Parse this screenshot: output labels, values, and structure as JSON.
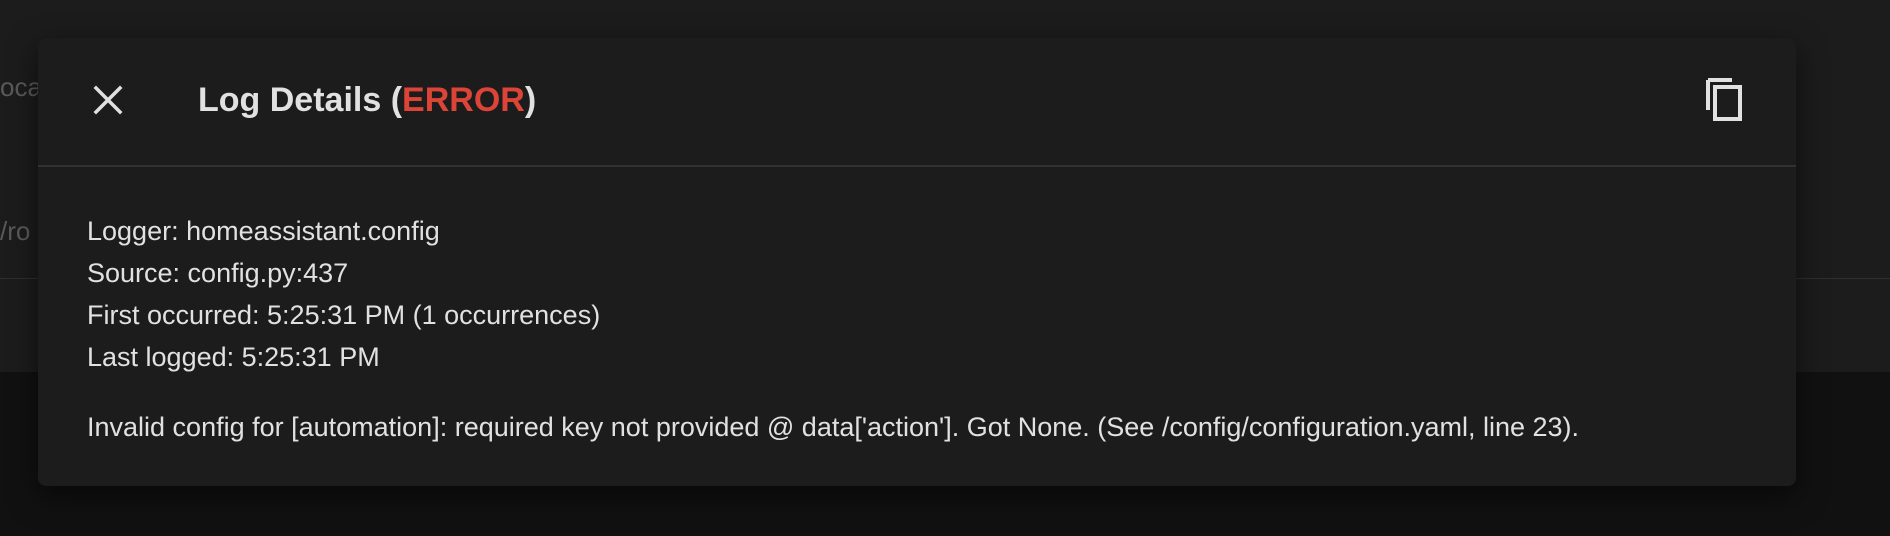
{
  "background": {
    "text_top": "oca",
    "text_bottom": "/ro"
  },
  "dialog": {
    "title_prefix": "Log Details (",
    "level": "ERROR",
    "title_suffix": ")",
    "close_icon": "close-icon",
    "copy_icon": "copy-icon",
    "details": {
      "logger": "Logger: homeassistant.config",
      "source": "Source: config.py:437",
      "first_occurred": "First occurred: 5:25:31 PM (1 occurrences)",
      "last_logged": "Last logged: 5:25:31 PM"
    },
    "message": "Invalid config for [automation]: required key not provided @ data['action']. Got None. (See /config/configuration.yaml, line 23)."
  },
  "colors": {
    "error": "#db4437",
    "dialog_bg": "#1c1c1c",
    "text": "#e1e1e1"
  }
}
